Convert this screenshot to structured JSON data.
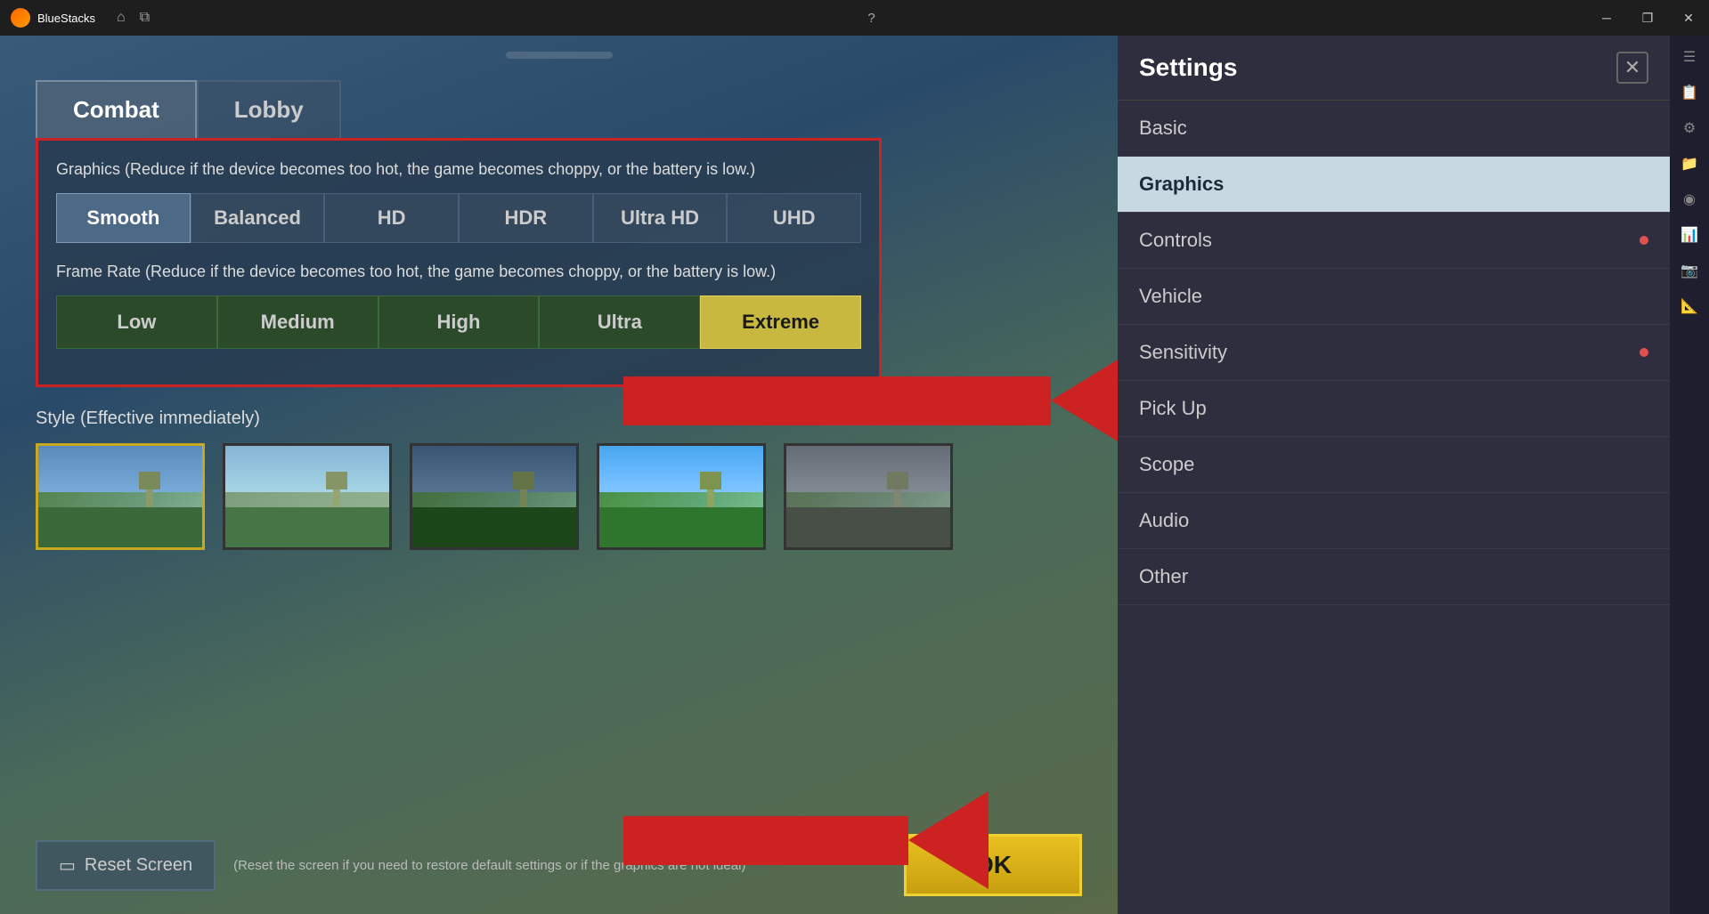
{
  "titlebar": {
    "app_name": "BlueStacks",
    "home_icon": "⌂",
    "copy_icon": "⧉",
    "help_icon": "?",
    "minimize_icon": "─",
    "restore_icon": "❐",
    "close_icon": "✕"
  },
  "tabs": {
    "combat_label": "Combat",
    "lobby_label": "Lobby"
  },
  "graphics_section": {
    "label": "Graphics (Reduce if the device becomes too hot, the game becomes choppy, or the battery is low.)",
    "options": [
      "Smooth",
      "Balanced",
      "HD",
      "HDR",
      "Ultra HD",
      "UHD"
    ],
    "active": "Smooth"
  },
  "framerate_section": {
    "label": "Frame Rate (Reduce if the device becomes too hot, the game becomes choppy, or the battery is low.)",
    "options": [
      "Low",
      "Medium",
      "High",
      "Ultra",
      "Extreme"
    ],
    "active": "Extreme"
  },
  "style_section": {
    "label": "Style (Effective immediately)",
    "thumbnails": 5
  },
  "bottom_bar": {
    "reset_icon": "▭",
    "reset_label": "Reset Screen",
    "reset_note": "(Reset the screen if you need to restore default settings or if the graphics are not ideal)",
    "ok_label": "OK"
  },
  "settings": {
    "title": "Settings",
    "close_icon": "✕",
    "nav_items": [
      {
        "label": "Basic",
        "has_dot": false
      },
      {
        "label": "Graphics",
        "active": true,
        "has_dot": false
      },
      {
        "label": "Controls",
        "has_dot": true
      },
      {
        "label": "Vehicle",
        "has_dot": false
      },
      {
        "label": "Sensitivity",
        "has_dot": true
      },
      {
        "label": "Pick Up",
        "has_dot": false
      },
      {
        "label": "Scope",
        "has_dot": false
      },
      {
        "label": "Audio",
        "has_dot": false
      },
      {
        "label": "Other",
        "has_dot": false
      }
    ]
  },
  "sidebar_icons": [
    "☰",
    "📋",
    "🔧",
    "📁",
    "⚙",
    "📊",
    "📷",
    "📐"
  ],
  "colors": {
    "accent_red": "#cc2222",
    "accent_gold": "#c8a820",
    "active_tab_bg": "rgba(80,100,120,0.8)",
    "nav_active_bg": "#c8d8e0"
  }
}
